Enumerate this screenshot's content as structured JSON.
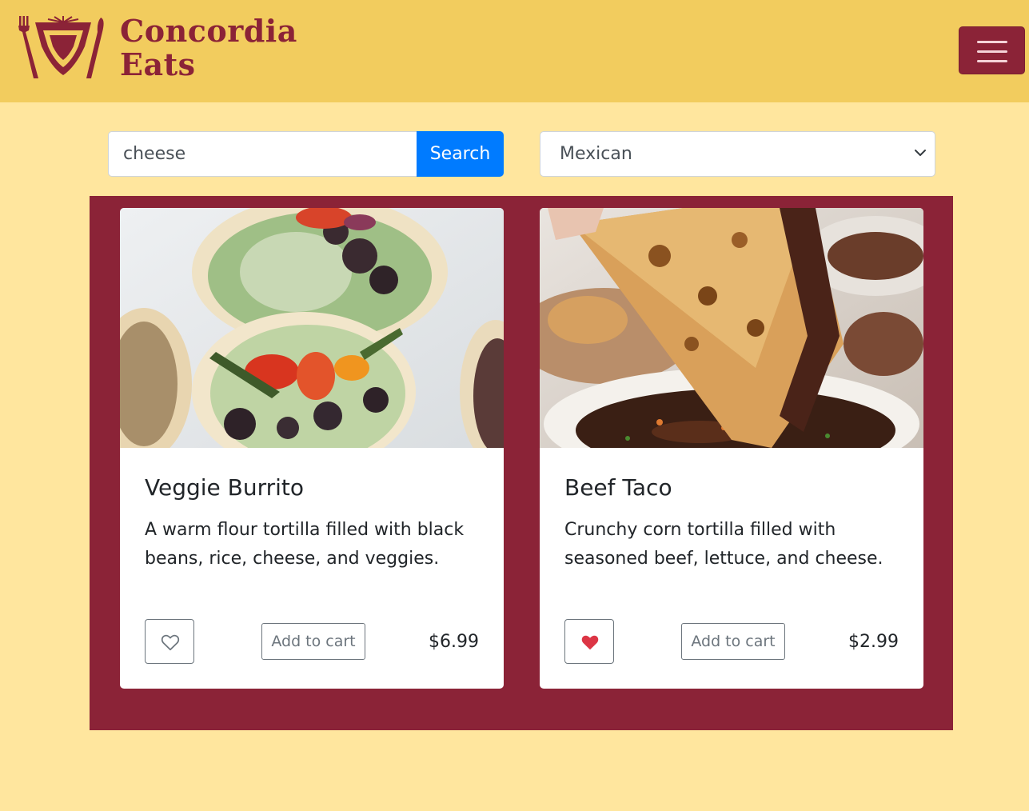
{
  "brand": {
    "line1": "Concordia",
    "line2": "Eats",
    "color": "#8b2337"
  },
  "header": {
    "background": "#f2cc5e",
    "menu_icon": "hamburger-icon"
  },
  "search": {
    "value": "cheese",
    "button_label": "Search"
  },
  "filter": {
    "selected": "Mexican",
    "icon": "chevron-down-icon"
  },
  "items": [
    {
      "title": "Veggie Burrito",
      "description": "A warm flour tortilla filled with black beans, rice, cheese, and veggies.",
      "favorited": false,
      "cart_label": "Add to cart",
      "price": "$6.99",
      "image": "burrito-photo"
    },
    {
      "title": "Beef Taco",
      "description": "Crunchy corn tortilla filled with seasoned beef, lettuce, and cheese.",
      "favorited": true,
      "cart_label": "Add to cart",
      "price": "$2.99",
      "image": "taco-photo"
    }
  ],
  "colors": {
    "page_bg": "#ffe69e",
    "panel_bg": "#8b2337",
    "primary": "#007bff",
    "heart": "#dc3545"
  }
}
